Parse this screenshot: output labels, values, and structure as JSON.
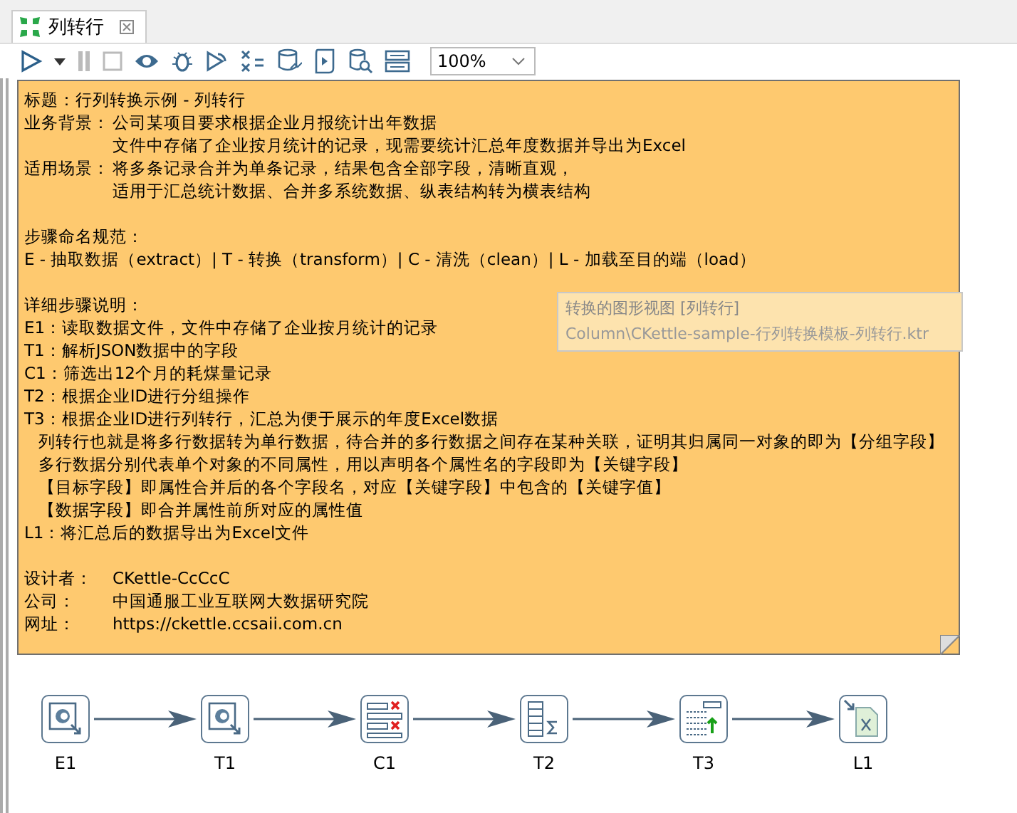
{
  "tab": {
    "title": "列转行",
    "selected": true
  },
  "toolbar": {
    "zoom": "100%"
  },
  "tooltip": {
    "title": "转换的图形视图 [列转行]",
    "path": "Column\\CKettle-sample-行列转换模板-列转行.ktr"
  },
  "note": {
    "groups": [
      [
        {
          "kind": "plain",
          "text": "标题：行列转换示例 - 列转行"
        },
        {
          "kind": "field",
          "label": "业务背景：",
          "lines": [
            "公司某项目要求根据企业月报统计出年数据",
            "文件中存储了企业按月统计的记录，现需要统计汇总年度数据并导出为Excel"
          ]
        },
        {
          "kind": "field",
          "label": "适用场景：",
          "lines": [
            "将多条记录合并为单条记录，结果包含全部字段，清晰直观，",
            "适用于汇总统计数据、合并多系统数据、纵表结构转为横表结构"
          ]
        }
      ],
      [
        {
          "kind": "plain",
          "text": "步骤命名规范："
        },
        {
          "kind": "plain",
          "text": "E - 抽取数据（extract）| T - 转换（transform）| C - 清洗（clean）| L - 加载至目的端（load）"
        }
      ],
      [
        {
          "kind": "plain",
          "text": "详细步骤说明："
        },
        {
          "kind": "plain",
          "text": "E1：读取数据文件，文件中存储了企业按月统计的记录"
        },
        {
          "kind": "plain",
          "text": "T1：解析JSON数据中的字段"
        },
        {
          "kind": "plain",
          "text": "C1：筛选出12个月的耗煤量记录"
        },
        {
          "kind": "plain",
          "text": "T2：根据企业ID进行分组操作"
        },
        {
          "kind": "plain",
          "text": "T3：根据企业ID进行列转行，汇总为便于展示的年度Excel数据"
        },
        {
          "kind": "sub",
          "text": "列转行也就是将多行数据转为单行数据，待合并的多行数据之间存在某种关联，证明其归属同一对象的即为【分组字段】"
        },
        {
          "kind": "sub",
          "text": "多行数据分别代表单个对象的不同属性，用以声明各个属性名的字段即为【关键字段】"
        },
        {
          "kind": "sub",
          "text": "【目标字段】即属性合并后的各个字段名，对应【关键字段】中包含的【关键字值】"
        },
        {
          "kind": "sub",
          "text": "【数据字段】即合并属性前所对应的属性值"
        },
        {
          "kind": "plain",
          "text": "L1：将汇总后的数据导出为Excel文件"
        }
      ],
      [
        {
          "kind": "field",
          "label": "设计者：",
          "lines": [
            "CKettle-CcCcC"
          ]
        },
        {
          "kind": "field",
          "label": "公司：",
          "lines": [
            "中国通服工业互联网大数据研究院"
          ]
        },
        {
          "kind": "field",
          "label": "网址：",
          "lines": [
            "https://ckettle.ccsaii.com.cn"
          ]
        }
      ]
    ]
  },
  "steps": [
    {
      "label": "E1",
      "kind": "input"
    },
    {
      "label": "T1",
      "kind": "input"
    },
    {
      "label": "C1",
      "kind": "filter"
    },
    {
      "label": "T2",
      "kind": "group"
    },
    {
      "label": "T3",
      "kind": "denormalize"
    },
    {
      "label": "L1",
      "kind": "excel"
    }
  ]
}
